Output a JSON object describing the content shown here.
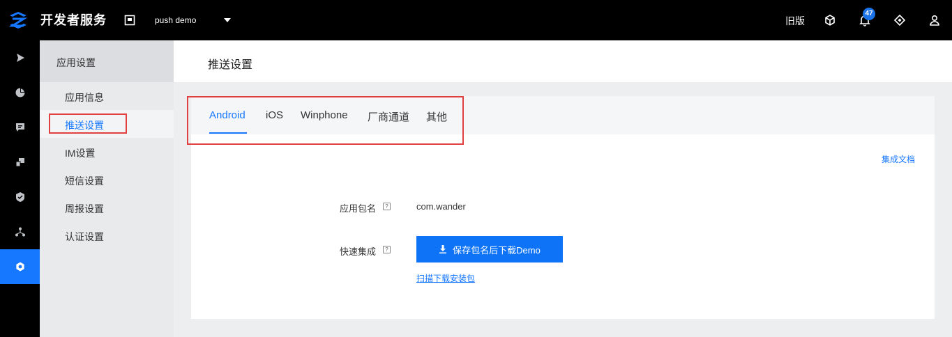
{
  "topbar": {
    "brand": "开发者服务",
    "app_name": "push demo",
    "old_version": "旧版",
    "notification_count": "47",
    "icons": [
      "logo-icon",
      "app-icon",
      "caret-down-icon",
      "cube-icon",
      "bell-icon",
      "diamond-icon",
      "user-icon"
    ]
  },
  "rail": {
    "items": [
      {
        "icon": "play-icon"
      },
      {
        "icon": "pie-chart-icon"
      },
      {
        "icon": "message-icon"
      },
      {
        "icon": "devices-icon"
      },
      {
        "icon": "shield-icon"
      },
      {
        "icon": "network-icon"
      },
      {
        "icon": "settings-icon",
        "active": true
      }
    ]
  },
  "sidebar": {
    "title": "应用设置",
    "items": [
      {
        "label": "应用信息"
      },
      {
        "label": "推送设置",
        "active": true
      },
      {
        "label": "IM设置"
      },
      {
        "label": "短信设置"
      },
      {
        "label": "周报设置"
      },
      {
        "label": "认证设置"
      }
    ]
  },
  "main": {
    "title": "推送设置",
    "tabs": [
      {
        "label": "Android",
        "active": true
      },
      {
        "label": "iOS"
      },
      {
        "label": "Winphone"
      },
      {
        "label": "厂商通道"
      },
      {
        "label": "其他"
      }
    ],
    "doc_link": "集成文档",
    "form": {
      "package_label": "应用包名",
      "package_value": "com.wander",
      "quick_label": "快速集成",
      "help_glyph": "?",
      "download_button": "保存包名后下载Demo",
      "scan_link": "扫描下载安装包"
    }
  },
  "colors": {
    "accent": "#1677ff",
    "topbar_bg": "#000000",
    "highlight_box": "#e04040"
  }
}
